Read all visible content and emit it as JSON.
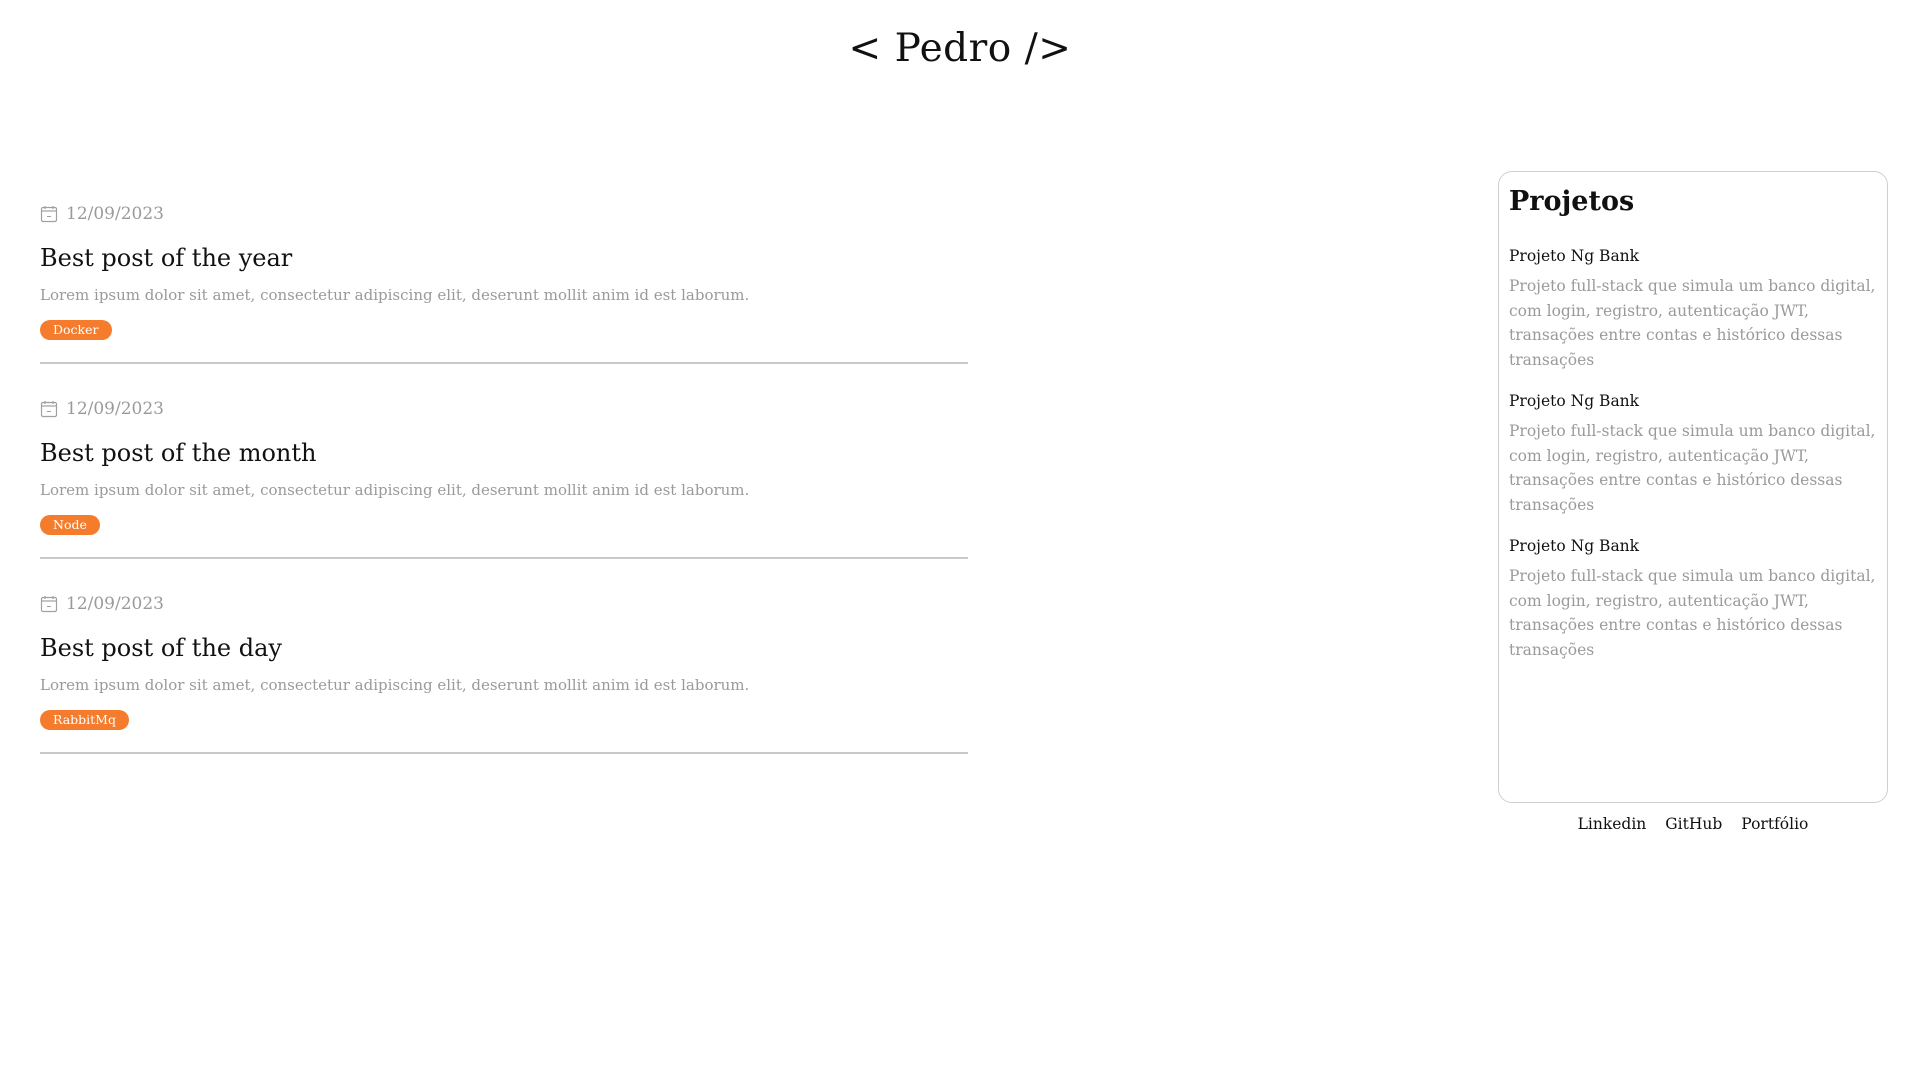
{
  "header": {
    "logo": "< Pedro />"
  },
  "posts": [
    {
      "date": "12/09/2023",
      "title": "Best post of the year",
      "excerpt": "Lorem ipsum dolor sit amet, consectetur adipiscing elit, deserunt mollit anim id est laborum.",
      "tag": "Docker"
    },
    {
      "date": "12/09/2023",
      "title": "Best post of the month",
      "excerpt": "Lorem ipsum dolor sit amet, consectetur adipiscing elit, deserunt mollit anim id est laborum.",
      "tag": "Node"
    },
    {
      "date": "12/09/2023",
      "title": "Best post of the day",
      "excerpt": "Lorem ipsum dolor sit amet, consectetur adipiscing elit, deserunt mollit anim id est laborum.",
      "tag": "RabbitMq"
    }
  ],
  "projects": {
    "title": "Projetos",
    "items": [
      {
        "name": "Projeto Ng Bank",
        "description": "Projeto full-stack que simula um banco digital, com login, registro, autenticação JWT, transações entre contas e histórico dessas transações"
      },
      {
        "name": "Projeto Ng Bank",
        "description": "Projeto full-stack que simula um banco digital, com login, registro, autenticação JWT, transações entre contas e histórico dessas transações"
      },
      {
        "name": "Projeto Ng Bank",
        "description": "Projeto full-stack que simula um banco digital, com login, registro, autenticação JWT, transações entre contas e histórico dessas transações"
      }
    ]
  },
  "footer": {
    "links": [
      "Linkedin",
      "GitHub",
      "Portfólio"
    ]
  },
  "colors": {
    "tag_background": "#f47c2c",
    "muted_text": "#9a9a9a",
    "divider": "#c9c9c9"
  },
  "icons": {
    "date": "calendar-icon"
  }
}
